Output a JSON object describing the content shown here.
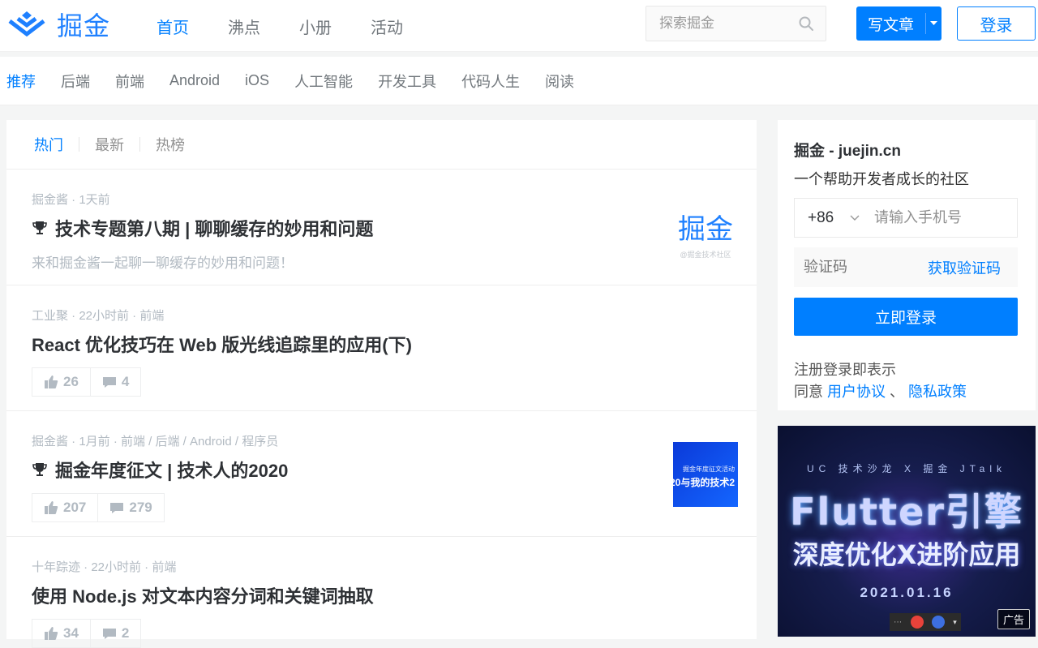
{
  "header": {
    "logo_text": "掘金",
    "nav": [
      "首页",
      "沸点",
      "小册",
      "活动"
    ],
    "search_placeholder": "探索掘金",
    "write_label": "写文章",
    "login_label": "登录"
  },
  "subnav": [
    "推荐",
    "后端",
    "前端",
    "Android",
    "iOS",
    "人工智能",
    "开发工具",
    "代码人生",
    "阅读"
  ],
  "feed": {
    "tabs": [
      "热门",
      "最新",
      "热榜"
    ],
    "items": [
      {
        "meta": "掘金酱 · 1天前",
        "title": "技术专题第八期 | 聊聊缓存的妙用和问题",
        "desc": "来和掘金酱一起聊一聊缓存的妙用和问题！",
        "thumb_big": "掘金",
        "thumb_small": "@掘金技术社区"
      },
      {
        "meta": "工业聚 · 22小时前 · 前端",
        "title": "React 优化技巧在 Web 版光线追踪里的应用(下)",
        "likes": "26",
        "comments": "4"
      },
      {
        "meta": "掘金酱 · 1月前 · 前端 / 后端 / Android / 程序员",
        "title": "掘金年度征文 | 技术人的2020",
        "likes": "207",
        "comments": "279",
        "thumb_t1": "掘金年度征文活动",
        "thumb_t2": "20与我的技术2"
      },
      {
        "meta": "十年踪迹 · 22小时前 · 前端",
        "title": "使用 Node.js 对文本内容分词和关键词抽取",
        "likes": "34",
        "comments": "2"
      }
    ]
  },
  "login_card": {
    "site": "掘金 - juejin.cn",
    "slogan": "一个帮助开发者成长的社区",
    "country_code": "+86",
    "phone_placeholder": "请输入手机号",
    "code_placeholder": "验证码",
    "get_code": "获取验证码",
    "submit": "立即登录",
    "terms_line1": "注册登录即表示",
    "terms_prefix": "同意",
    "user_agreement": "用户协议",
    "terms_sep": "、",
    "privacy_policy": "隐私政策"
  },
  "ad": {
    "line1": "UC 技术沙龙 X 掘金 JTalk",
    "line2": "Flutter引擎",
    "line3": "深度优化X进阶应用",
    "line4": "2021.01.16",
    "badge": "广告"
  },
  "colors": {
    "brand": "#007fff",
    "muted": "#b2bac2",
    "title": "#2e3135"
  }
}
